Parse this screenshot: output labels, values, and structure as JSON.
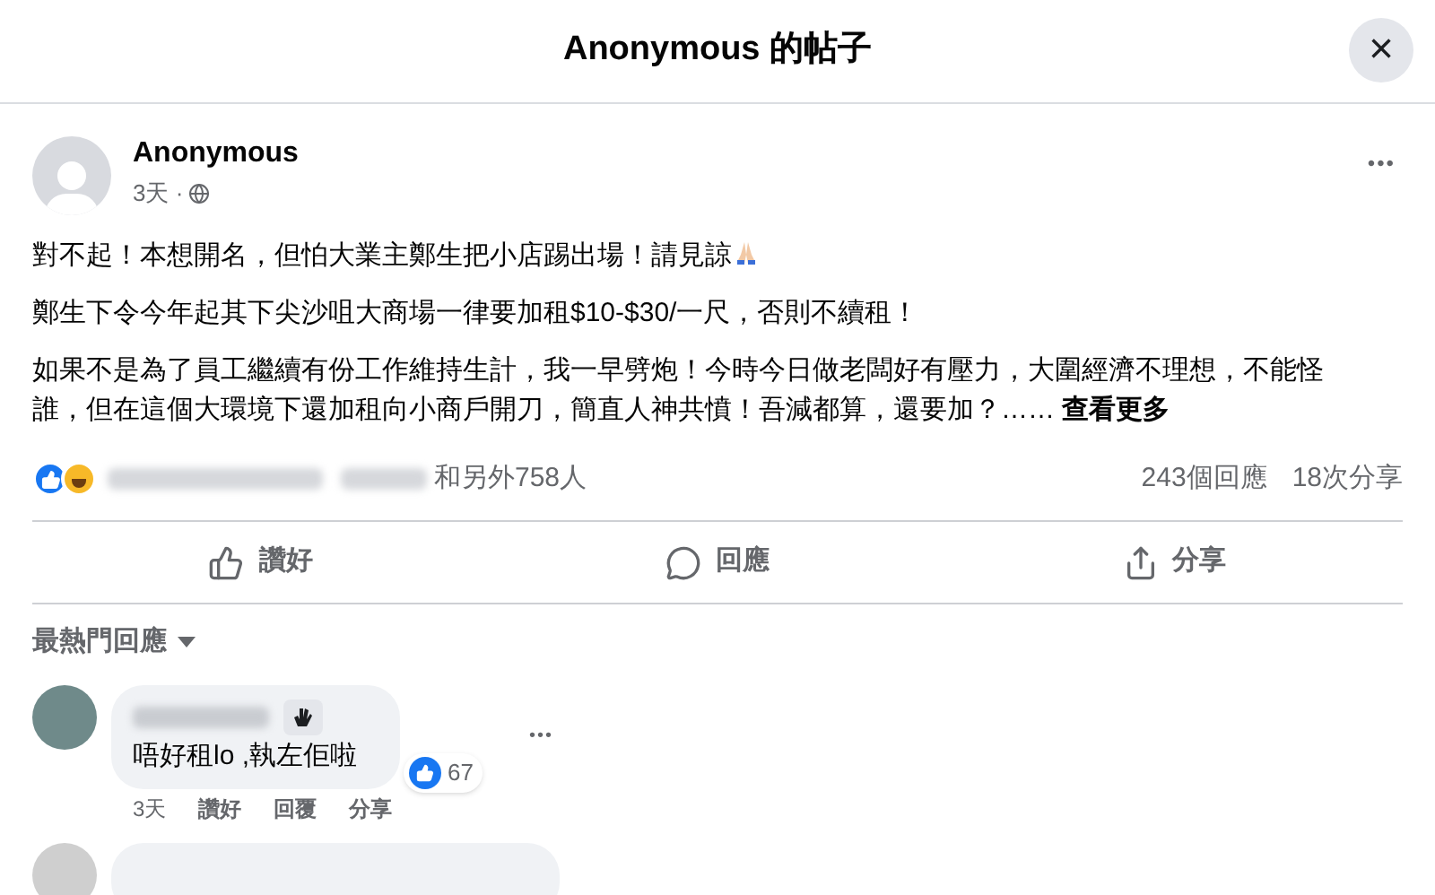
{
  "dialog": {
    "title": "Anonymous 的帖子",
    "close": "×"
  },
  "post": {
    "author": "Anonymous",
    "time": "3天 ·",
    "more": "•••",
    "paragraphs": [
      "對不起！本想開名，但怕大業主鄭生把小店踢出場！請見諒",
      "鄭生下令今年起其下尖沙咀大商場一律要加租$10-$30/一尺，否則不續租！",
      "如果不是為了員工繼續有份工作維持生計，我一早劈炮！今時今日做老闆好有壓力，大圍經濟不理想，不能怪誰，但在這個大環境下還加租向小商戶開刀，簡直人神共憤！吾減都算，還要加？……"
    ],
    "see_more": "查看更多",
    "reactions_text": "和另外758人",
    "comments_count": "243個回應",
    "shares_count": "18次分享"
  },
  "actions": [
    {
      "kind": "like",
      "label": "讚好"
    },
    {
      "kind": "comment",
      "label": "回應"
    },
    {
      "kind": "share",
      "label": "分享"
    }
  ],
  "sort": {
    "label": "最熱門回應"
  },
  "comments": [
    {
      "text": "唔好租lo ,執左佢啦",
      "likes": "67",
      "time": "3天",
      "actions": [
        "讚好",
        "回覆",
        "分享"
      ],
      "more": "•••"
    }
  ]
}
